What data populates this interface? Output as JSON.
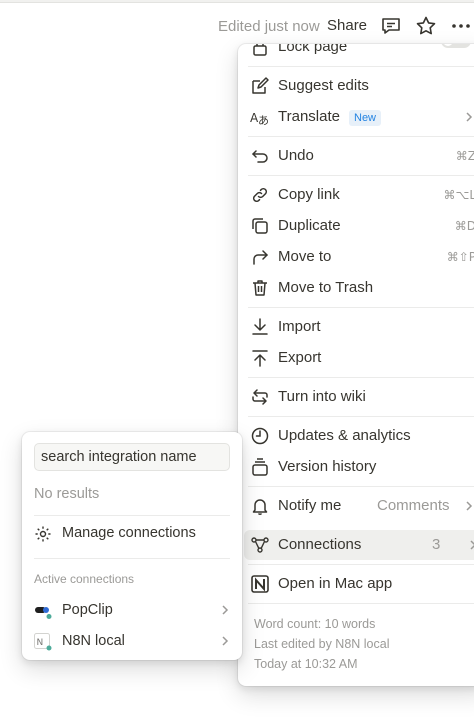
{
  "topbar": {
    "edited_text": "Edited just now",
    "share_label": "Share",
    "icons": [
      "comment-icon",
      "star-icon",
      "more-icon"
    ]
  },
  "menu": {
    "lock_label": "Lock page",
    "items": [
      {
        "label": "Suggest edits",
        "icon": "suggest-edit-icon"
      },
      {
        "label": "Translate",
        "icon": "translate-icon",
        "badge": "New"
      },
      {
        "label": "Undo",
        "icon": "undo-icon",
        "shortcut": "⌘Z"
      },
      {
        "label": "Copy link",
        "icon": "link-icon",
        "shortcut": "⌘⌥L"
      },
      {
        "label": "Duplicate",
        "icon": "duplicate-icon",
        "shortcut": "⌘D"
      },
      {
        "label": "Move to",
        "icon": "move-to-icon",
        "shortcut": "⌘⇧P"
      },
      {
        "label": "Move to Trash",
        "icon": "trash-icon"
      },
      {
        "label": "Import",
        "icon": "import-icon"
      },
      {
        "label": "Export",
        "icon": "export-icon"
      },
      {
        "label": "Turn into wiki",
        "icon": "wiki-icon"
      },
      {
        "label": "Updates & analytics",
        "icon": "clock-icon"
      },
      {
        "label": "Version history",
        "icon": "history-icon"
      },
      {
        "label": "Notify me",
        "icon": "bell-icon",
        "value": "Comments"
      },
      {
        "label": "Connections",
        "icon": "connections-icon",
        "value": "3"
      },
      {
        "label": "Open in Mac app",
        "icon": "notion-logo-icon"
      }
    ],
    "footer": {
      "word_count": "Word count: 10 words",
      "last_edited": "Last edited by N8N local",
      "timestamp": "Today at 10:32 AM"
    }
  },
  "connections_panel": {
    "search_value": "search integration name",
    "no_results": "No results",
    "manage_label": "Manage connections",
    "section_title": "Active connections",
    "connections": [
      {
        "label": "PopClip",
        "icon": "popclip-icon"
      },
      {
        "label": "N8N local",
        "icon": "n8n-icon"
      }
    ]
  },
  "colors": {
    "text": "#37352f",
    "muted": "#9b9a97",
    "accent": "#2383e2",
    "online": "#4dab9a"
  }
}
